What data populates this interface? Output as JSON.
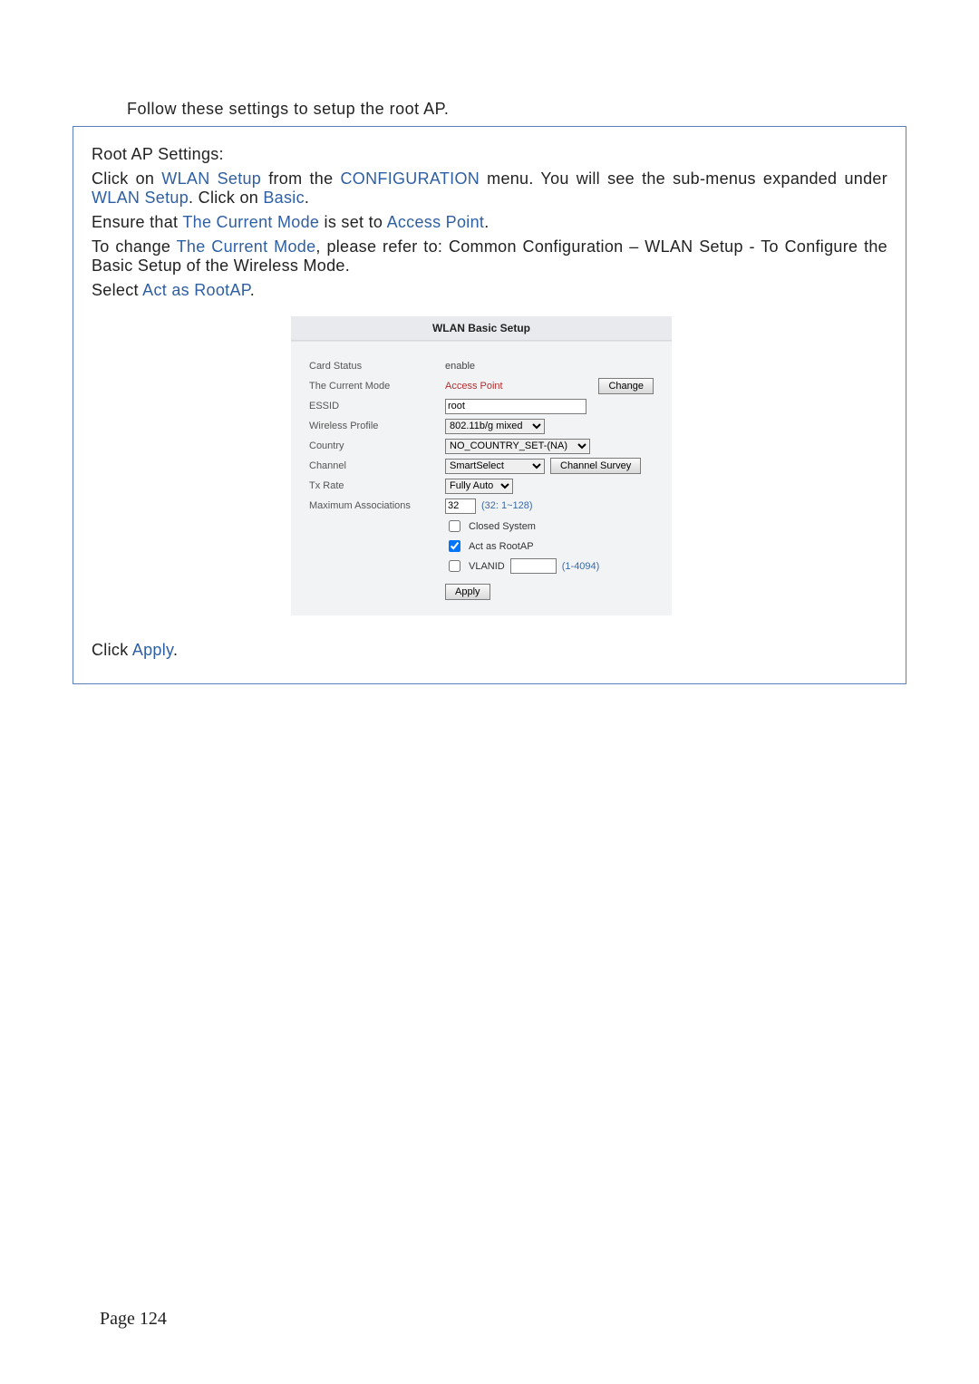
{
  "intro": "Follow these settings to setup the root AP.",
  "box": {
    "heading": "Root AP Settings:",
    "p1_pre": "Click on ",
    "p1_wlan": "WLAN Setup",
    "p1_mid1": " from the ",
    "p1_conf": "CONFIGURATION",
    "p1_mid2": " menu. You will see the sub-menus expanded under ",
    "p1_wlan2": "WLAN Setup",
    "p1_mid3": ". Click on ",
    "p1_basic": "Basic",
    "p1_end": ".",
    "p2_pre": "Ensure that ",
    "p2_mode": "The Current Mode",
    "p2_mid": " is set to ",
    "p2_ap": "Access Point",
    "p2_end": ".",
    "p3_pre": "To change ",
    "p3_mode": "The Current Mode",
    "p3_rest": ", please refer to: Common Configuration – WLAN Setup - To Configure the Basic Setup of the Wireless Mode.",
    "p4_pre": "Select ",
    "p4_root": "Act as RootAP",
    "p4_end": ".",
    "p5_pre": "Click ",
    "p5_apply": "Apply",
    "p5_end": "."
  },
  "config": {
    "title": "WLAN Basic Setup",
    "labels": {
      "card_status": "Card Status",
      "current_mode": "The Current Mode",
      "essid": "ESSID",
      "wireless_profile": "Wireless Profile",
      "country": "Country",
      "channel": "Channel",
      "tx_rate": "Tx Rate",
      "max_assoc": "Maximum Associations"
    },
    "values": {
      "card_status": "enable",
      "current_mode": "Access Point",
      "essid": "root",
      "wireless_profile": "802.11b/g mixed",
      "country": "NO_COUNTRY_SET-(NA)",
      "channel": "SmartSelect",
      "tx_rate": "Fully Auto",
      "max_assoc": "32",
      "max_assoc_hint": "(32: 1~128)",
      "closed_system": "Closed System",
      "act_as_rootap": "Act as RootAP",
      "vlanid_label": "VLANID",
      "vlanid_value": "",
      "vlanid_hint": "(1-4094)"
    },
    "buttons": {
      "change": "Change",
      "channel_survey": "Channel Survey",
      "apply": "Apply"
    },
    "checks": {
      "closed_system": false,
      "act_as_rootap": true,
      "vlanid": false
    }
  },
  "footer": "Page 124"
}
